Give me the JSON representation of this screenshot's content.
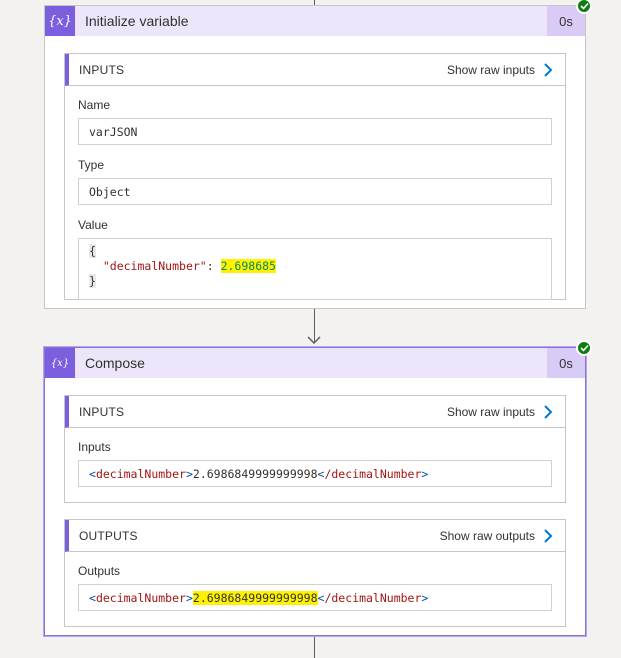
{
  "card1": {
    "icon": "{x}",
    "title": "Initialize variable",
    "duration": "0s",
    "inputs": {
      "title": "INPUTS",
      "show_raw_label": "Show raw inputs",
      "name_label": "Name",
      "name_value": "varJSON",
      "type_label": "Type",
      "type_value": "Object",
      "value_label": "Value",
      "json_open": "{",
      "json_key": "\"decimalNumber\"",
      "json_colon": ": ",
      "json_number": "2.698685",
      "json_close": "}"
    }
  },
  "card2": {
    "icon": "{x}",
    "title": "Compose",
    "duration": "0s",
    "inputs": {
      "title": "INPUTS",
      "show_raw_label": "Show raw inputs",
      "inputs_label": "Inputs",
      "open_tag": "decimalNumber",
      "value": "2.6986849999999998",
      "close_tag": "/decimalNumber"
    },
    "outputs": {
      "title": "OUTPUTS",
      "show_raw_label": "Show raw outputs",
      "outputs_label": "Outputs",
      "open_tag": "decimalNumber",
      "value": "2.6986849999999998",
      "close_tag": "/decimalNumber"
    }
  },
  "icons": {
    "variable": "variable-icon",
    "chevron": "chevron-right-icon",
    "success": "success-check-icon",
    "arrow": "arrow-down-icon"
  },
  "colors": {
    "accent": "#7b5fdf",
    "header_bg": "#ede6fb",
    "success": "#107c10",
    "highlight": "#fff200",
    "link_chevron": "#0078d4"
  }
}
